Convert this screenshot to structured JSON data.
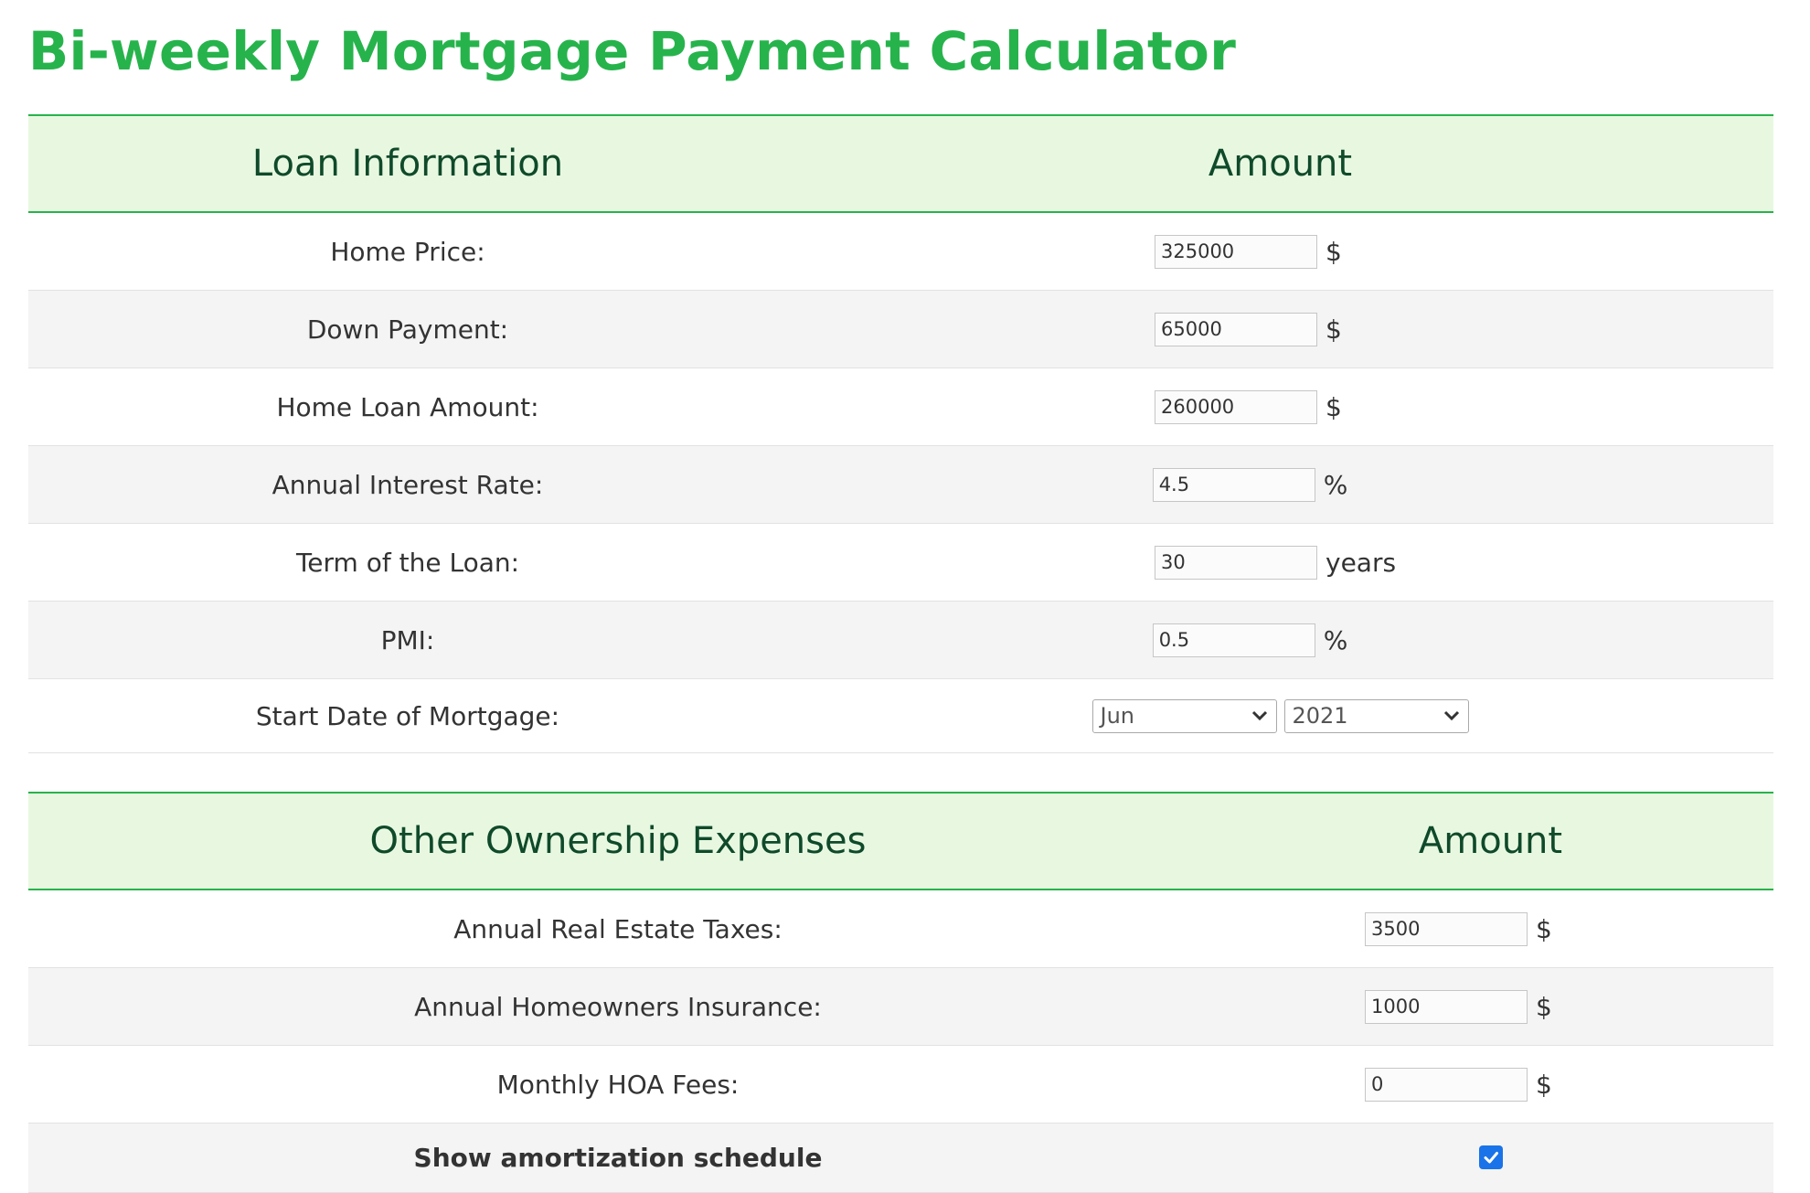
{
  "title": "Bi-weekly Mortgage Payment Calculator",
  "loan_section": {
    "header_label": "Loan Information",
    "header_amount": "Amount",
    "rows": [
      {
        "label": "Home Price:",
        "value": "325000",
        "unit": "$"
      },
      {
        "label": "Down Payment:",
        "value": "65000",
        "unit": "$"
      },
      {
        "label": "Home Loan Amount:",
        "value": "260000",
        "unit": "$"
      },
      {
        "label": "Annual Interest Rate",
        "suffix": ":",
        "value": "4.5",
        "unit": "%"
      },
      {
        "label": "Term of the Loan:",
        "value": "30",
        "unit": "years"
      },
      {
        "label": "PMI:",
        "value": "0.5",
        "unit": "%"
      }
    ],
    "start_date": {
      "label": "Start Date of Mortgage:",
      "month": "Jun",
      "year": "2021"
    }
  },
  "expense_section": {
    "header_label": "Other Ownership Expenses",
    "header_amount": "Amount",
    "rows": [
      {
        "label": "Annual Real Estate Taxes:",
        "value": "3500",
        "unit": "$"
      },
      {
        "label": "Annual Homeowners Insurance:",
        "value": "1000",
        "unit": "$"
      },
      {
        "label": "Monthly HOA Fees:",
        "value": "0",
        "unit": "$"
      }
    ],
    "amortization": {
      "label": "Show amortization schedule",
      "checked": true
    }
  },
  "colors": {
    "accent": "#27b34c",
    "header_bg": "#e8f8e0",
    "checkbox": "#1a73e8"
  },
  "icons": {
    "select_arrow": "chevron-down-icon",
    "checkbox": "checkmark-icon"
  }
}
